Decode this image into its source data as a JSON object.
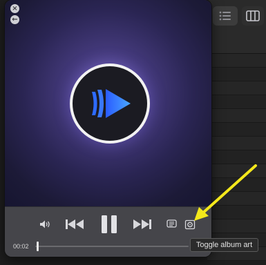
{
  "player": {
    "close_glyph": "×",
    "back_glyph": "←",
    "elapsed": "00:02",
    "remaining": "-",
    "progress_fraction": 0.01,
    "icons": {
      "volume": "volume-icon",
      "previous": "previous-track-icon",
      "pause": "pause-icon",
      "next": "next-track-icon",
      "lyrics": "lyrics-icon",
      "album_art": "album-art-toggle-icon"
    }
  },
  "tooltip": {
    "text": "Toggle album art"
  },
  "colors": {
    "annotation_arrow": "#f4e81b",
    "play_accent": "#3a7bff"
  }
}
